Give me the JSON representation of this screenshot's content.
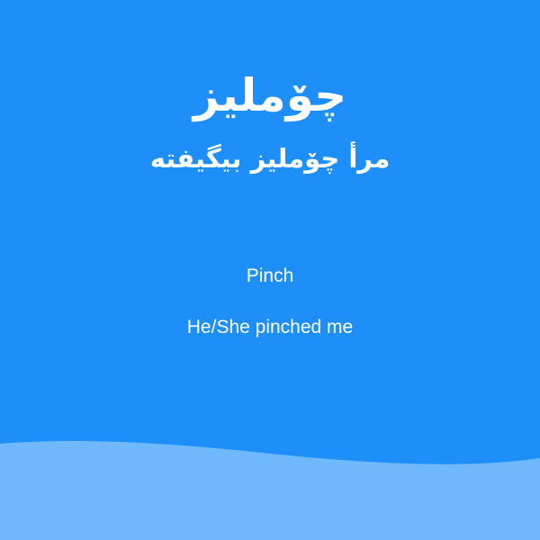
{
  "card": {
    "word": "چۆملیز",
    "sentence": "مرأ چۆملیز بیگیفته",
    "translation_word": "Pinch",
    "translation_sentence": "He/She pinched me"
  },
  "colors": {
    "background": "#1e8ff9",
    "wave": "#6fb8fb",
    "text": "#ffffff"
  }
}
